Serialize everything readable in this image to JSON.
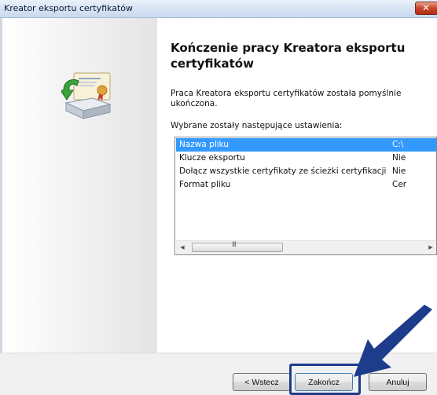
{
  "window": {
    "title": "Kreator eksportu certyfikatów",
    "close_glyph": "✕"
  },
  "wizard": {
    "heading": "Kończenie pracy Kreatora eksportu certyfikatów",
    "intro": "Praca Kreatora eksportu certyfikatów została pomyślnie ukończona.",
    "settings_label": "Wybrane zostały następujące ustawienia:"
  },
  "settings": {
    "rows": [
      {
        "name": "Nazwa pliku",
        "value": "C:\\",
        "selected": true
      },
      {
        "name": "Klucze eksportu",
        "value": "Nie"
      },
      {
        "name": "Dołącz wszystkie certyfikaty ze ścieżki certyfikacji",
        "value": "Nie"
      },
      {
        "name": "Format pliku",
        "value": "Cer"
      }
    ],
    "scroll_left": "◀",
    "scroll_right": "▶",
    "scroll_grip": "III"
  },
  "buttons": {
    "back": "< Wstecz",
    "finish": "Zakończ",
    "cancel": "Anuluj"
  },
  "colors": {
    "selection": "#3399ff",
    "pointer_arrow": "#1e3c8c",
    "focus_box": "#1e3c8c"
  },
  "icons": [
    "certificate-export-icon",
    "close-icon",
    "pointer-arrow"
  ]
}
